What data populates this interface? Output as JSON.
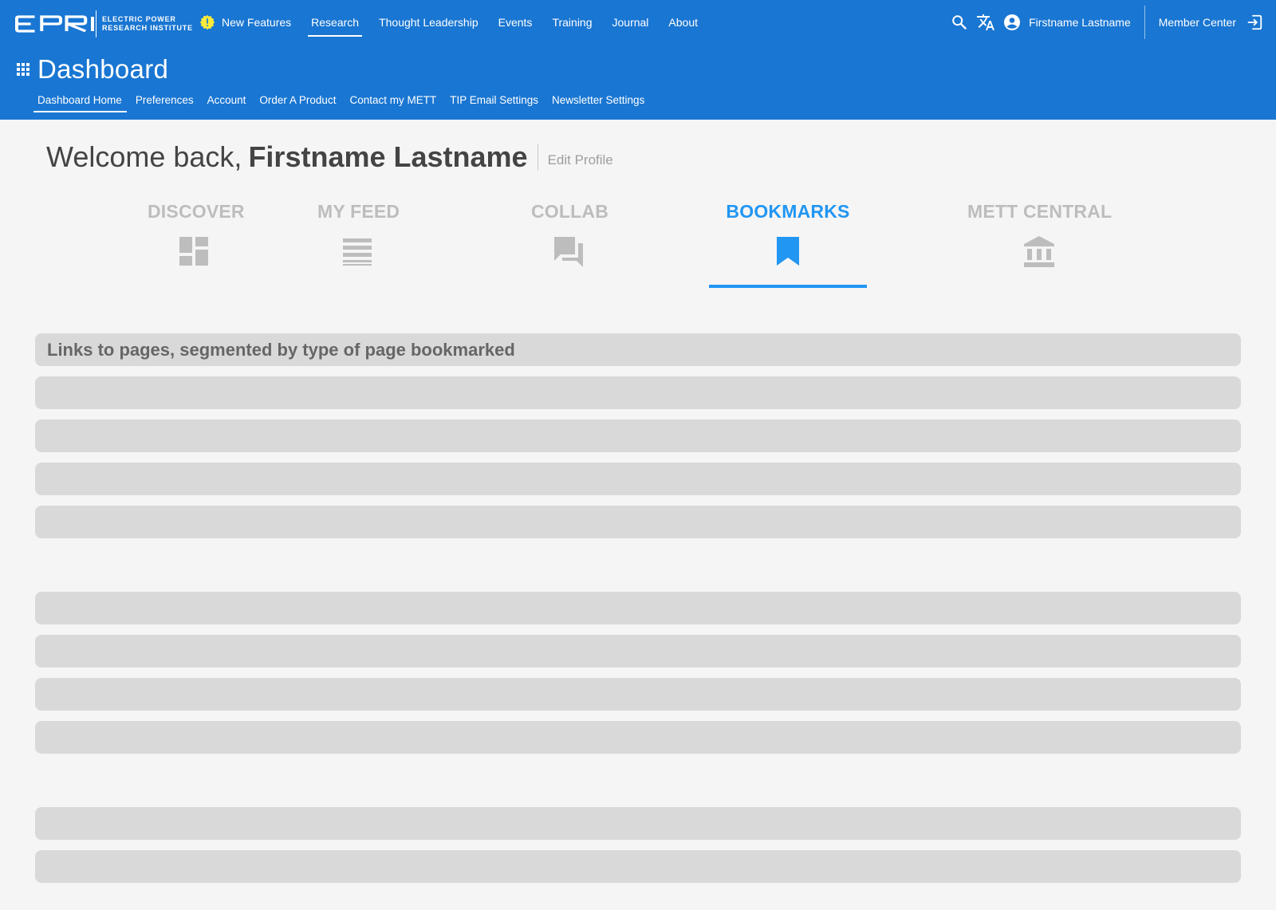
{
  "brand": {
    "logo_text": "EPRI",
    "subtitle_line1": "ELECTRIC POWER",
    "subtitle_line2": "RESEARCH INSTITUTE"
  },
  "topnav": {
    "new_features": "New Features",
    "items": [
      "Research",
      "Thought Leadership",
      "Events",
      "Training",
      "Journal",
      "About"
    ],
    "active": "Research",
    "accent_color": "#ffeb3b"
  },
  "user": {
    "name": "Firstname Lastname",
    "member_center": "Member Center"
  },
  "dashboard": {
    "title": "Dashboard",
    "subnav": [
      "Dashboard Home",
      "Preferences",
      "Account",
      "Order A Product",
      "Contact my METT",
      "TIP Email Settings",
      "Newsletter Settings"
    ],
    "active": "Dashboard Home"
  },
  "welcome": {
    "greeting": "Welcome back,",
    "name": "Firstname Lastname",
    "edit_profile": "Edit Profile"
  },
  "tabs": [
    {
      "label": "DISCOVER",
      "icon": "dashboard-icon"
    },
    {
      "label": "MY FEED",
      "icon": "list-icon"
    },
    {
      "label": "COLLAB",
      "icon": "forum-icon"
    },
    {
      "label": "BOOKMARKS",
      "icon": "bookmark-icon",
      "active": true
    },
    {
      "label": "METT CENTRAL",
      "icon": "institution-icon"
    }
  ],
  "bookmarks": {
    "header": "Links to pages, segmented by type of page bookmarked"
  },
  "colors": {
    "header_bg": "#1976d2",
    "active_tab": "#2196f3",
    "inactive_tab": "#bdbdbd",
    "placeholder_bar": "#d9d9d9",
    "page_bg": "#f5f5f5"
  }
}
